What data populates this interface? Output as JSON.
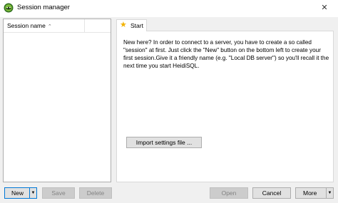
{
  "window": {
    "title": "Session manager",
    "close_glyph": "✕"
  },
  "session_list": {
    "column_header": "Session name",
    "sort_glyph": "⌃"
  },
  "tab": {
    "label": "Start",
    "icon": "star-icon",
    "icon_glyph": "★",
    "intro_text": "New here? In order to connect to a server, you have to create a so called \"session\" at first. Just click the \"New\" button on the bottom left to create your first session.Give it a friendly name (e.g. \"Local DB server\") so you'll recall it the next time you start HeidiSQL.",
    "import_label": "Import settings file ..."
  },
  "footer": {
    "new_label": "New",
    "save_label": "Save",
    "delete_label": "Delete",
    "open_label": "Open",
    "cancel_label": "Cancel",
    "more_label": "More",
    "dropdown_glyph": "▼"
  },
  "colors": {
    "tab_star": "#f2b200",
    "focus_border": "#0078d7"
  }
}
